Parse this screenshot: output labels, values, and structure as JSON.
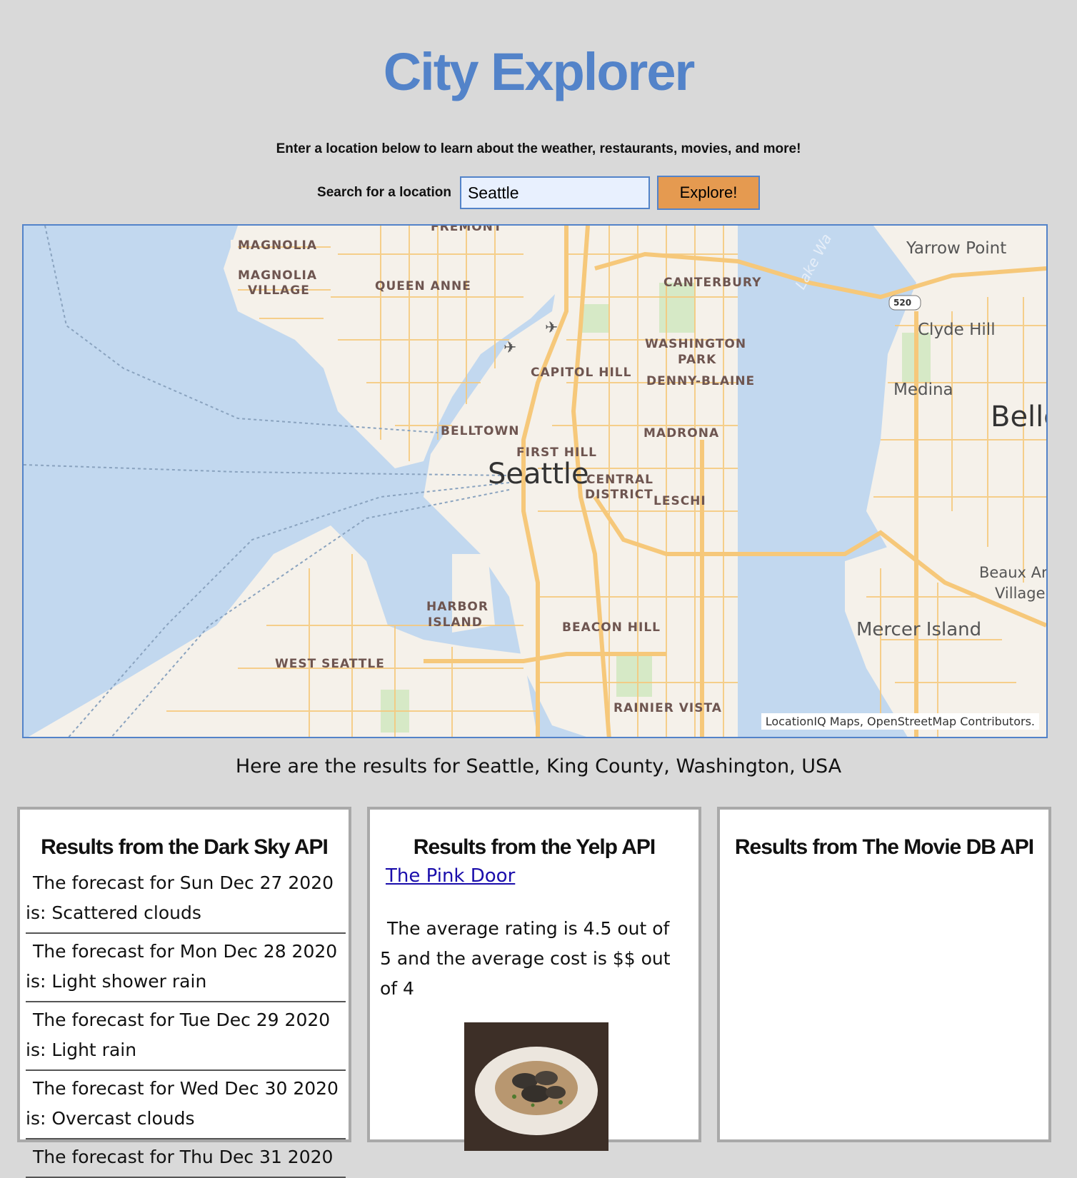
{
  "header": {
    "title": "City Explorer",
    "tagline": "Enter a location below to learn about the weather, restaurants, movies, and more!"
  },
  "search": {
    "label": "Search for a location",
    "value": "Seattle",
    "button_label": "Explore!"
  },
  "map": {
    "attribution": "LocationIQ Maps, OpenStreetMap Contributors.",
    "labels": {
      "magnolia": "MAGNOLIA",
      "magnolia_village_1": "MAGNOLIA",
      "magnolia_village_2": "VILLAGE",
      "queen_anne": "QUEEN ANNE",
      "fremont": "FREMONT",
      "canterbury": "CANTERBURY",
      "yarrow_point": "Yarrow Point",
      "clyde_hill": "Clyde Hill",
      "medina": "Medina",
      "bellevue": "Belle",
      "washington_park_1": "WASHINGTON",
      "washington_park_2": "PARK",
      "capitol_hill": "CAPITOL HILL",
      "denny_blaine": "DENNY-BLAINE",
      "belltown": "BELLTOWN",
      "madrona": "MADRONA",
      "first_hill": "FIRST HILL",
      "seattle": "Seattle",
      "central_district_1": "CENTRAL",
      "central_district_2": "DISTRICT",
      "leschi": "LESCHI",
      "beaux_arts_1": "Beaux Ar",
      "beaux_arts_2": "Village",
      "harbor_island_1": "HARBOR",
      "harbor_island_2": "ISLAND",
      "beacon_hill": "BEACON HILL",
      "mercer_island": "Mercer Island",
      "west_seattle": "WEST SEATTLE",
      "rainier_vista": "RAINIER VISTA",
      "lake_washington": "Lake Wa",
      "route_520": "520"
    },
    "colors": {
      "water": "#c2d8ef",
      "land": "#f5f1ea",
      "road": "#f6c87a",
      "park": "#d6e9c6"
    }
  },
  "results_heading": "Here are the results for Seattle, King County, Washington, USA",
  "darksky": {
    "heading": "Results from the Dark Sky API",
    "forecasts": [
      "The forecast for Sun Dec 27 2020 is: Scattered clouds",
      "The forecast for Mon Dec 28 2020 is: Light shower rain",
      "The forecast for Tue Dec 29 2020 is: Light rain",
      "The forecast for Wed Dec 30 2020 is: Overcast clouds",
      "The forecast for Thu Dec 31 2020"
    ]
  },
  "yelp": {
    "heading": "Results from the Yelp API",
    "name": "The Pink Door",
    "summary": "The average rating is 4.5 out of 5 and the average cost is $$ out of 4"
  },
  "moviedb": {
    "heading": "Results from The Movie DB API"
  }
}
